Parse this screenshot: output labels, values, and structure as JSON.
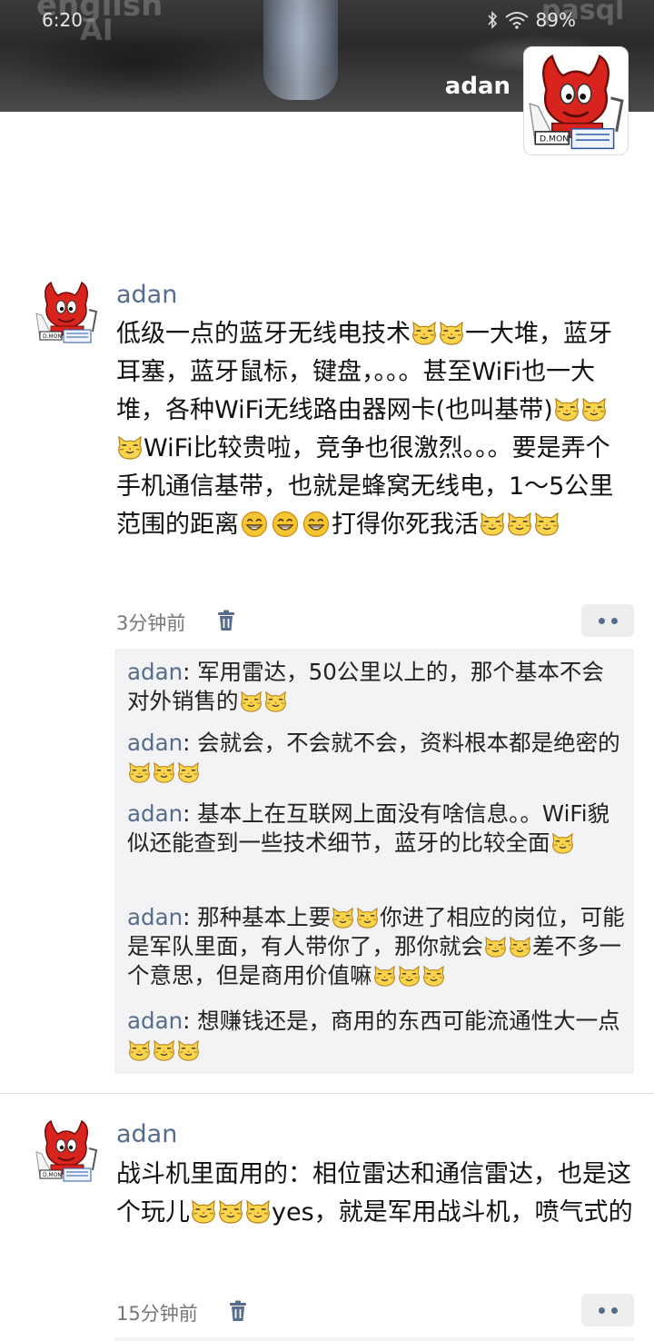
{
  "status_bar": {
    "time": "6:20",
    "battery": "89%"
  },
  "header": {
    "user_name": "adan"
  },
  "posts": [
    {
      "author": "adan",
      "text_parts": [
        "低级一点的蓝牙无线电技术",
        "一大堆，蓝牙耳塞，蓝牙鼠标，键盘，。。。甚至WiFi也一大堆，各种WiFi无线路由器网卡(也叫基带)",
        "WiFi比较贵啦，竞争也很激烈。。。要是弄个手机通信基带，也就是蜂窝无线电，1～5公里范围的距离",
        "打得你死我活"
      ],
      "time": "3分钟前",
      "comments": [
        {
          "author": "adan",
          "text": ": 军用雷达，50公里以上的，那个基本不会对外销售的"
        },
        {
          "author": "adan",
          "text": ": 会就会，不会就不会，资料根本都是绝密的"
        },
        {
          "author": "adan",
          "text": ": 基本上在互联网上面没有啥信息。。WiFi貌似还能查到一些技术细节，蓝牙的比较全面"
        },
        {
          "author": "adan",
          "text_parts": [
            ": 那种基本上要",
            "你进了相应的岗位，可能是军队里面，有人带你了，那你就会",
            "差不多一个意思，但是商用价值嘛"
          ]
        },
        {
          "author": "adan",
          "text": ": 想赚钱还是，商用的东西可能流通性大一点"
        }
      ]
    },
    {
      "author": "adan",
      "text_parts": [
        "战斗机里面用的：相位雷达和通信雷达，也是这个玩儿",
        "yes，就是军用战斗机，喷气式的"
      ],
      "time": "15分钟前"
    }
  ],
  "colors": {
    "name_blue": "#566c8b",
    "comment_bg": "#f3f3f5",
    "more_bg": "#eeeeee"
  },
  "icons": [
    "cat-emoji-icon",
    "grin-emoji-icon",
    "trash-icon",
    "more-icon",
    "wifi-icon",
    "bluetooth-icon",
    "avatar-devil-icon"
  ]
}
